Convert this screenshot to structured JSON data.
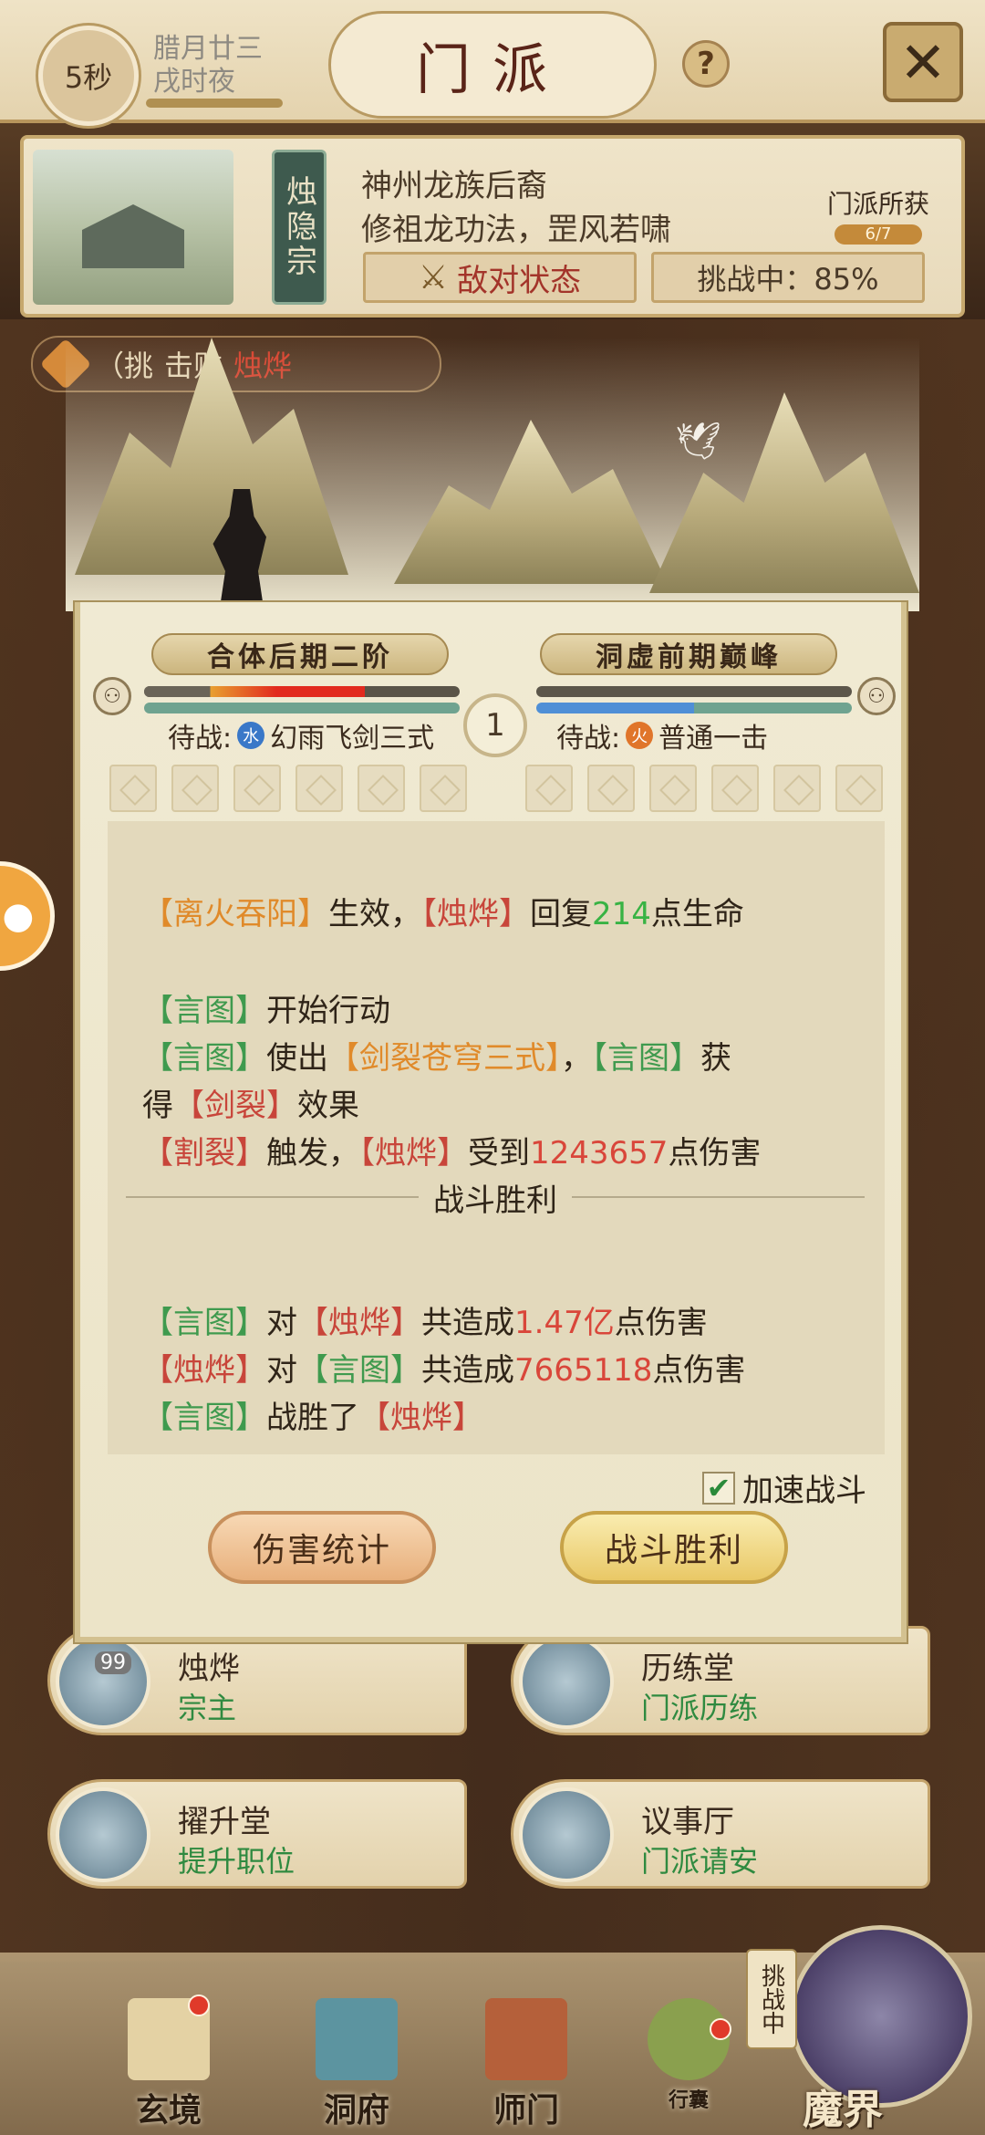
{
  "topbar": {
    "timer": "5秒",
    "date_line1": "腊月廿三",
    "date_line2": "戌时夜",
    "title": "门派",
    "help": "?",
    "close": "✕"
  },
  "sect": {
    "name": "烛隐宗",
    "desc1": "神州龙族后裔",
    "desc2": "修祖龙功法，罡风若啸",
    "enemy_status": "敌对状态",
    "challenge": "挑战中：85%",
    "gain_label": "门派所获",
    "gain_count": "6/7"
  },
  "notice": {
    "prefix": "（挑",
    "middle": "击败",
    "target": "烛烨"
  },
  "battle": {
    "left_rank": "合体后期二阶",
    "right_rank": "洞虚前期巅峰",
    "round": "1",
    "left_waiting_prefix": "待战:",
    "left_element": "水",
    "left_skill": "幻雨飞剑三式",
    "right_waiting_prefix": "待战:",
    "right_element": "火",
    "right_skill": "普通一击",
    "left_hp": 0.7,
    "right_hp": 1.0,
    "log": {
      "l1_a": "【离火吞阳】",
      "l1_b": "生效，",
      "l1_c": "【烛烨】",
      "l1_d": "回复",
      "l1_e": "214",
      "l1_f": "点生命",
      "l2_a": "【言图】",
      "l2_b": "开始行动",
      "l3_a": "【言图】",
      "l3_b": "使出",
      "l3_c": "【剑裂苍穹三式】",
      "l3_d": "，",
      "l3_e": "【言图】",
      "l3_f": "获",
      "l4_a": "得",
      "l4_b": "【剑裂】",
      "l4_c": "效果",
      "l5_a": "【割裂】",
      "l5_b": "触发，",
      "l5_c": "【烛烨】",
      "l5_d": "受到",
      "l5_e": "1243657",
      "l5_f": "点伤害",
      "divider": "战斗胜利",
      "l6_a": "【言图】",
      "l6_b": "对",
      "l6_c": "【烛烨】",
      "l6_d": "共造成",
      "l6_e": "1.47亿",
      "l6_f": "点伤害",
      "l7_a": "【烛烨】",
      "l7_b": "对",
      "l7_c": "【言图】",
      "l7_d": "共造成",
      "l7_e": "7665118",
      "l7_f": "点伤害",
      "l8_a": "【言图】",
      "l8_b": "战胜了",
      "l8_c": "【烛烨】"
    },
    "speed_label": "加速战斗",
    "speed_checked": true,
    "btn_stats": "伤害统计",
    "btn_victory": "战斗胜利"
  },
  "cards": [
    {
      "title": "烛烨",
      "sub": "宗主"
    },
    {
      "title": "历练堂",
      "sub": "门派历练"
    },
    {
      "title": "擢升堂",
      "sub": "提升职位"
    },
    {
      "title": "议事厅",
      "sub": "门派请安"
    }
  ],
  "badge": "99",
  "nav": {
    "item1": "玄境",
    "item2": "洞府",
    "item3": "师门",
    "item4": "行囊",
    "challenge_tag": "挑战中",
    "item5": "魔界"
  },
  "colors": {
    "log_orange": "#e08a2a",
    "log_red": "#c8453a",
    "log_green": "#3f9a4e",
    "heal_green": "#38b344",
    "damage_red": "#d9463a"
  }
}
